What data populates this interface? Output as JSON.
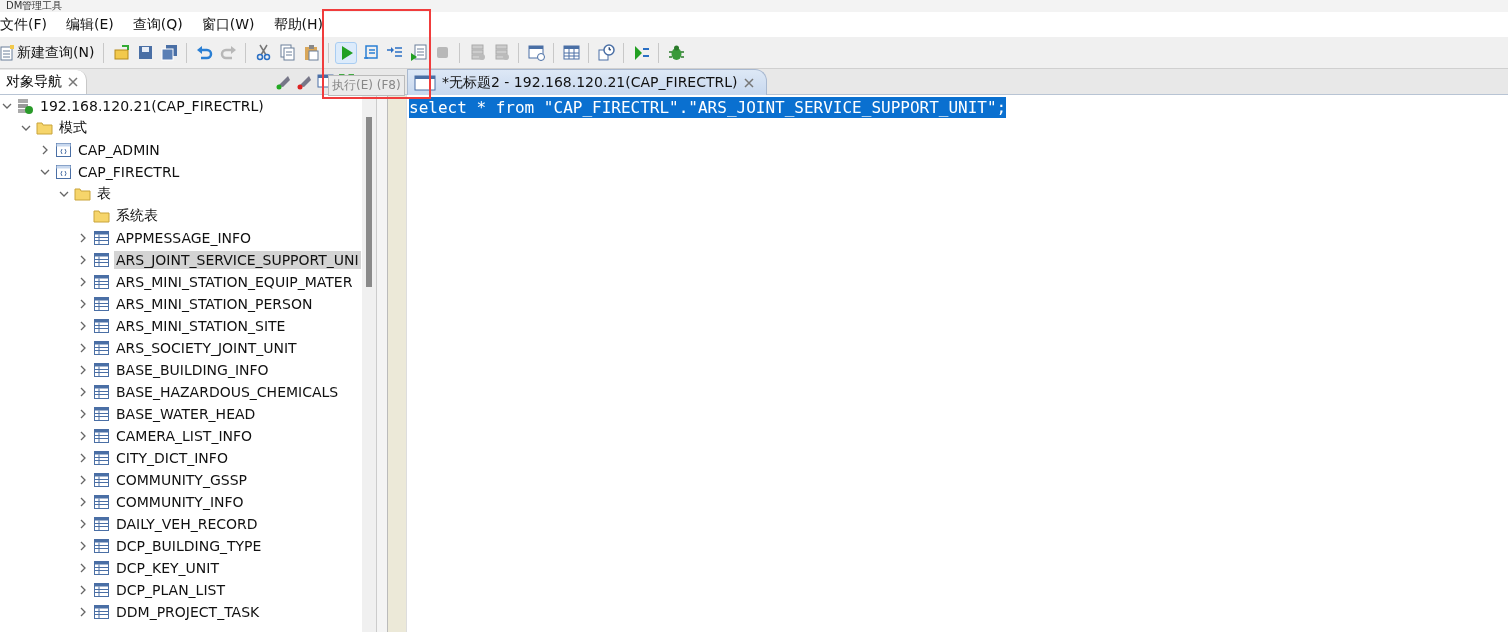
{
  "window": {
    "title": "DM管理工具"
  },
  "menu": [
    "文件(F)",
    "编辑(E)",
    "查询(Q)",
    "窗口(W)",
    "帮助(H)"
  ],
  "toolbar": [
    {
      "kind": "new-query",
      "label": "新建查询(N)"
    },
    {
      "kind": "sep"
    },
    {
      "kind": "open"
    },
    {
      "kind": "save"
    },
    {
      "kind": "save-all"
    },
    {
      "kind": "sep"
    },
    {
      "kind": "undo"
    },
    {
      "kind": "redo",
      "disabled": true
    },
    {
      "kind": "sep"
    },
    {
      "kind": "cut"
    },
    {
      "kind": "copy"
    },
    {
      "kind": "paste"
    },
    {
      "kind": "sep"
    },
    {
      "kind": "run",
      "selected": true
    },
    {
      "kind": "step"
    },
    {
      "kind": "indent"
    },
    {
      "kind": "script"
    },
    {
      "kind": "stop",
      "disabled": true
    },
    {
      "kind": "sep"
    },
    {
      "kind": "db",
      "disabled": true
    },
    {
      "kind": "db",
      "disabled": true
    },
    {
      "kind": "sep"
    },
    {
      "kind": "schedule"
    },
    {
      "kind": "sep"
    },
    {
      "kind": "grid"
    },
    {
      "kind": "sep"
    },
    {
      "kind": "history"
    },
    {
      "kind": "sep"
    },
    {
      "kind": "run-split"
    },
    {
      "kind": "sep"
    },
    {
      "kind": "bug"
    }
  ],
  "tooltip": "执行(E) (F8)",
  "navigator": {
    "title": "对象导航",
    "tree": [
      {
        "label": "192.168.120.21(CAP_FIRECTRL)",
        "kind": "server",
        "expanded": true,
        "selected": false,
        "children": [
          {
            "label": "模式",
            "kind": "folder",
            "expanded": true,
            "selected": false,
            "children": [
              {
                "label": "CAP_ADMIN",
                "kind": "schema",
                "expanded": false,
                "selected": false
              },
              {
                "label": "CAP_FIRECTRL",
                "kind": "schema",
                "expanded": true,
                "selected": false,
                "children": [
                  {
                    "label": "表",
                    "kind": "folder",
                    "expanded": true,
                    "selected": false,
                    "children": [
                      {
                        "label": "系统表",
                        "kind": "folder-leaf",
                        "selected": false
                      },
                      {
                        "label": "APPMESSAGE_INFO",
                        "kind": "table",
                        "expanded": false,
                        "selected": false
                      },
                      {
                        "label": "ARS_JOINT_SERVICE_SUPPORT_UNI",
                        "kind": "table",
                        "expanded": false,
                        "selected": true
                      },
                      {
                        "label": "ARS_MINI_STATION_EQUIP_MATER",
                        "kind": "table",
                        "expanded": false,
                        "selected": false
                      },
                      {
                        "label": "ARS_MINI_STATION_PERSON",
                        "kind": "table",
                        "expanded": false,
                        "selected": false
                      },
                      {
                        "label": "ARS_MINI_STATION_SITE",
                        "kind": "table",
                        "expanded": false,
                        "selected": false
                      },
                      {
                        "label": "ARS_SOCIETY_JOINT_UNIT",
                        "kind": "table",
                        "expanded": false,
                        "selected": false
                      },
                      {
                        "label": "BASE_BUILDING_INFO",
                        "kind": "table",
                        "expanded": false,
                        "selected": false
                      },
                      {
                        "label": "BASE_HAZARDOUS_CHEMICALS",
                        "kind": "table",
                        "expanded": false,
                        "selected": false
                      },
                      {
                        "label": "BASE_WATER_HEAD",
                        "kind": "table",
                        "expanded": false,
                        "selected": false
                      },
                      {
                        "label": "CAMERA_LIST_INFO",
                        "kind": "table",
                        "expanded": false,
                        "selected": false
                      },
                      {
                        "label": "CITY_DICT_INFO",
                        "kind": "table",
                        "expanded": false,
                        "selected": false
                      },
                      {
                        "label": "COMMUNITY_GSSP",
                        "kind": "table",
                        "expanded": false,
                        "selected": false
                      },
                      {
                        "label": "COMMUNITY_INFO",
                        "kind": "table",
                        "expanded": false,
                        "selected": false
                      },
                      {
                        "label": "DAILY_VEH_RECORD",
                        "kind": "table",
                        "expanded": false,
                        "selected": false
                      },
                      {
                        "label": "DCP_BUILDING_TYPE",
                        "kind": "table",
                        "expanded": false,
                        "selected": false
                      },
                      {
                        "label": "DCP_KEY_UNIT",
                        "kind": "table",
                        "expanded": false,
                        "selected": false
                      },
                      {
                        "label": "DCP_PLAN_LIST",
                        "kind": "table",
                        "expanded": false,
                        "selected": false
                      },
                      {
                        "label": "DDM_PROJECT_TASK",
                        "kind": "table",
                        "expanded": false,
                        "selected": false
                      }
                    ]
                  }
                ]
              }
            ]
          }
        ]
      }
    ]
  },
  "editor": {
    "tab": "*无标题2 - 192.168.120.21(CAP_FIRECTRL)",
    "lines": [
      {
        "text": "select * from \"CAP_FIRECTRL\".\"ARS_JOINT_SERVICE_SUPPORT_UNIT\";",
        "selected": true
      }
    ]
  }
}
